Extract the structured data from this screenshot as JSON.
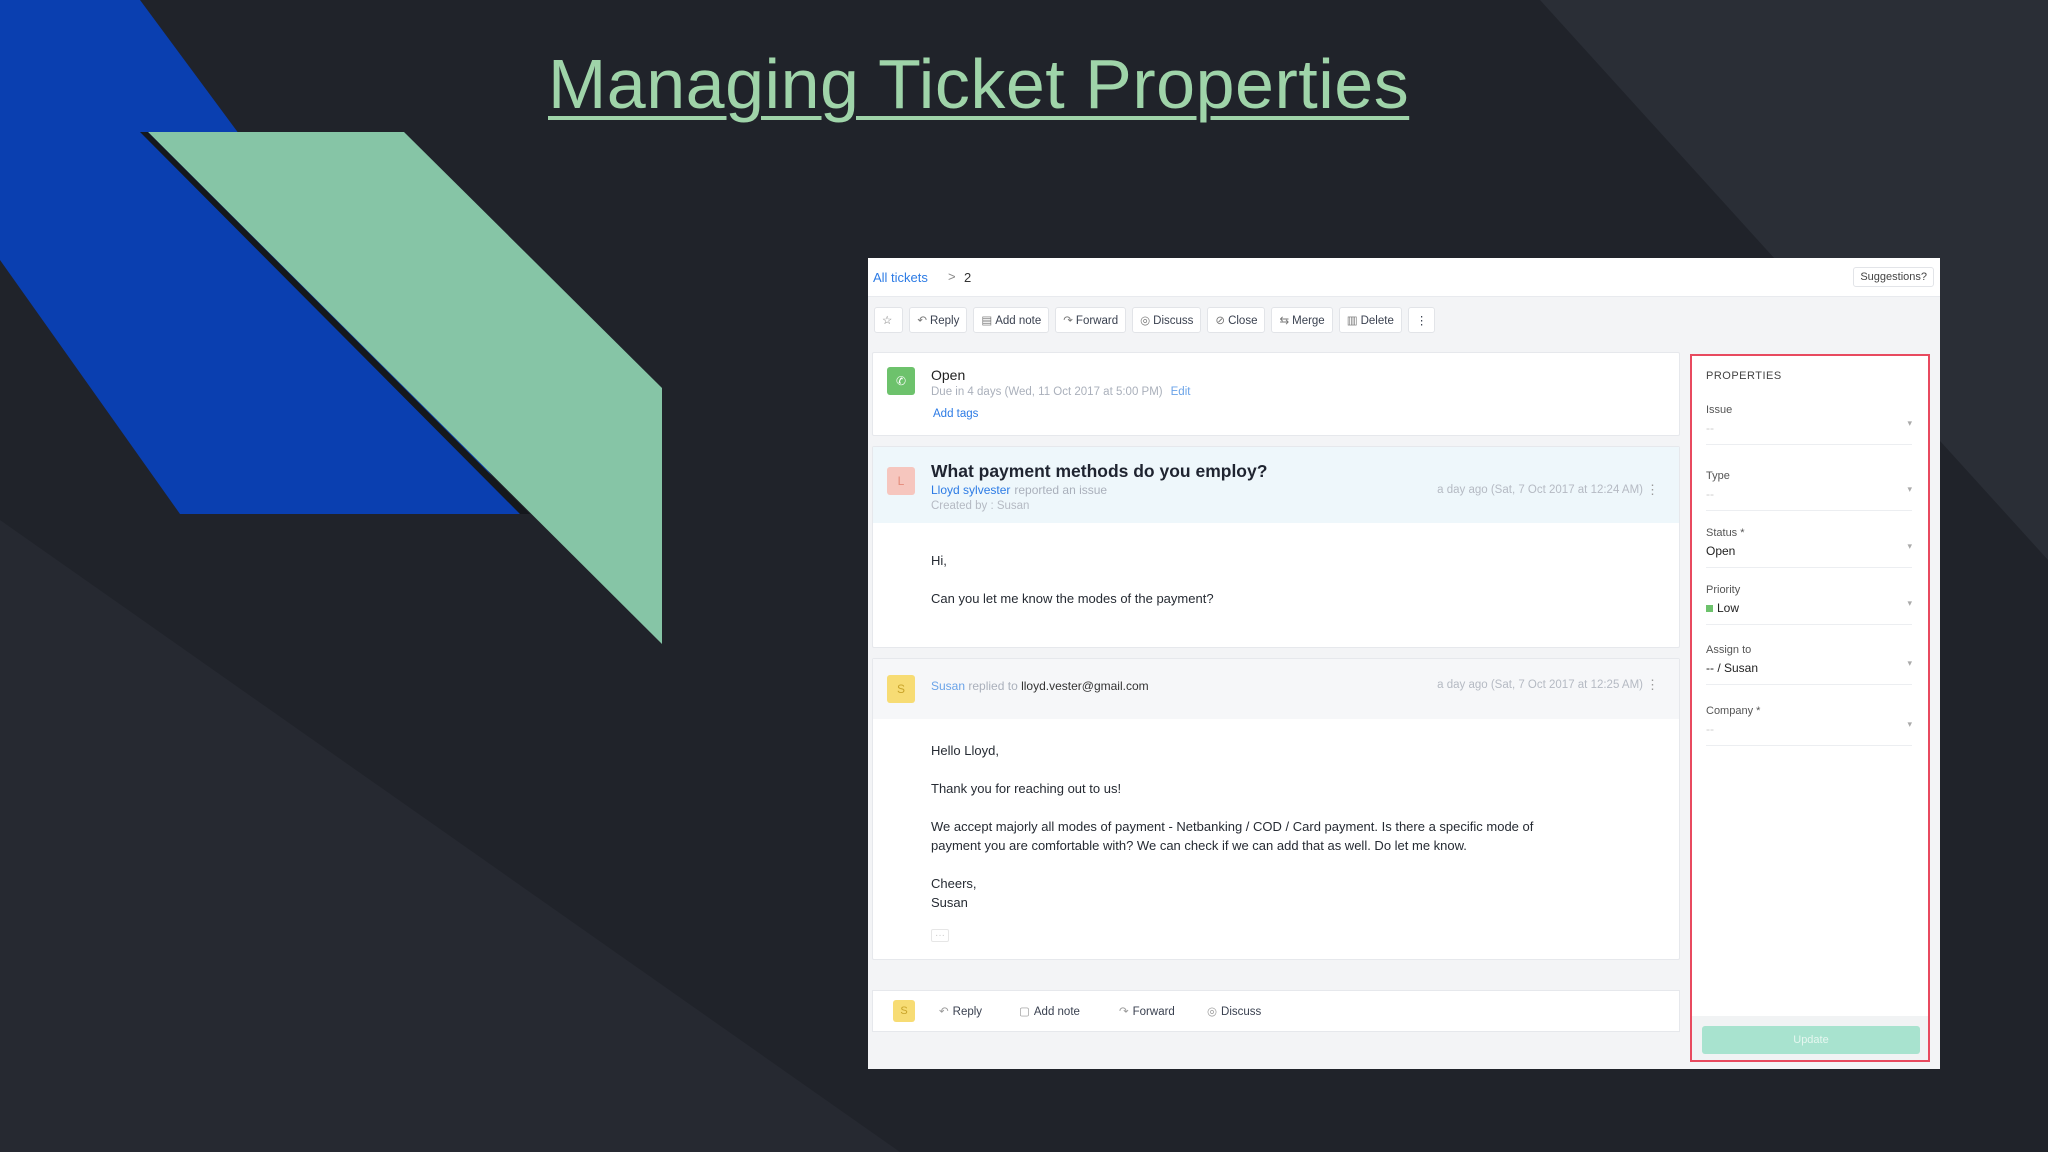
{
  "slide": {
    "title": "Managing Ticket Properties"
  },
  "breadcrumb": {
    "link": "All tickets",
    "separator": ">",
    "ticket_id": "2"
  },
  "suggestions_label": "Suggestions?",
  "toolbar": {
    "items": [
      {
        "label": "",
        "icon": "star-icon"
      },
      {
        "label": "Reply",
        "icon": "reply-icon"
      },
      {
        "label": "Add note",
        "icon": "note-icon"
      },
      {
        "label": "Forward",
        "icon": "forward-icon"
      },
      {
        "label": "Discuss",
        "icon": "discuss-icon"
      },
      {
        "label": "Close",
        "icon": "check-circle-icon"
      },
      {
        "label": "Merge",
        "icon": "merge-icon"
      },
      {
        "label": "Delete",
        "icon": "trash-icon"
      },
      {
        "label": "⋮",
        "icon": "more-icon"
      }
    ]
  },
  "status": {
    "label": "Open",
    "due": "Due in 4 days (Wed, 11 Oct 2017 at 5:00 PM)",
    "edit": "Edit",
    "add_tags": "Add tags"
  },
  "question": {
    "avatar": "L",
    "subject": "What payment methods do you employ?",
    "reporter": "Lloyd sylvester",
    "action": "reported an issue",
    "created_by": "Created by : Susan",
    "time": "a day ago (Sat, 7 Oct 2017 at 12:24 AM)",
    "body": [
      "Hi,",
      "Can you let me know the modes of the payment?"
    ]
  },
  "reply": {
    "avatar": "S",
    "author": "Susan",
    "action": "replied to",
    "email": "lloyd.vester@gmail.com",
    "time": "a day ago (Sat, 7 Oct 2017 at 12:25 AM)",
    "body": [
      "Hello Lloyd,",
      "Thank you for reaching out to us!",
      "We accept majorly all modes of payment - Netbanking / COD / Card payment. Is there a specific mode of",
      "payment you are comfortable with? We can check if we can add that as well. Do let me know.",
      "Cheers,",
      "Susan"
    ],
    "ellipsis": "···"
  },
  "bottom_bar": {
    "avatar": "S",
    "reply": "Reply",
    "add_note": "Add note",
    "forward": "Forward",
    "discuss": "Discuss"
  },
  "properties": {
    "title": "PROPERTIES",
    "fields": [
      {
        "label": "Issue",
        "value": "--"
      },
      {
        "label": "Type",
        "value": "--"
      },
      {
        "label": "Status *",
        "value": "Open"
      },
      {
        "label": "Priority",
        "value": "Low"
      },
      {
        "label": "Assign to",
        "value": "-- / Susan"
      },
      {
        "label": "Company *",
        "value": "--"
      }
    ],
    "update_button": "Update"
  },
  "colors": {
    "background": "#20232a",
    "stripe_blue": "#0a3fb0",
    "stripe_green": "#86c5a6",
    "title": "#9fd4a9",
    "highlight_border": "#e84a5f",
    "link": "#2c7be5",
    "priority_low": "#6dc26c"
  }
}
